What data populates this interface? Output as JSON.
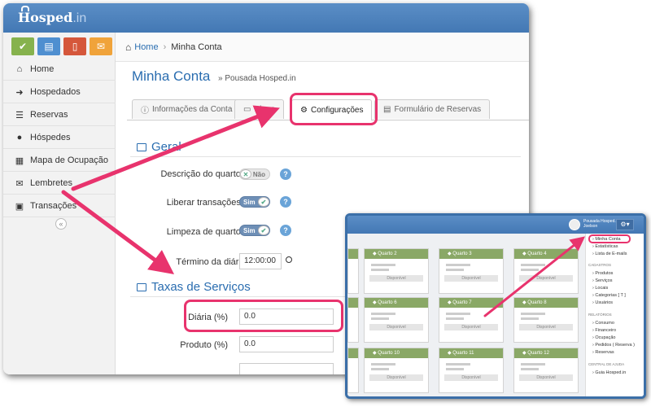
{
  "app": {
    "logo": "Hosped",
    "logo_dot": ".in"
  },
  "sidebar": {
    "quick_buttons": [
      {
        "icon": "check-icon",
        "color": "#86b24d"
      },
      {
        "icon": "book-icon",
        "color": "#4f8fd0"
      },
      {
        "icon": "tablet-icon",
        "color": "#d5573b"
      },
      {
        "icon": "inbox-icon",
        "color": "#f0a33a"
      }
    ],
    "items": [
      {
        "label": "Home",
        "icon": "home-icon"
      },
      {
        "label": "Hospedados",
        "icon": "sign-in-icon"
      },
      {
        "label": "Reservas",
        "icon": "list-icon"
      },
      {
        "label": "Hóspedes",
        "icon": "users-icon"
      },
      {
        "label": "Mapa de Ocupação",
        "icon": "calendar-icon"
      },
      {
        "label": "Lembretes",
        "icon": "envelope-icon"
      },
      {
        "label": "Transações",
        "icon": "money-icon"
      }
    ]
  },
  "breadcrumb": {
    "home": "Home",
    "current": "Minha Conta"
  },
  "page": {
    "title": "Minha Conta",
    "subtitle": "» Pousada Hosped.in"
  },
  "tabs": [
    {
      "label": "Informações da Conta",
      "icon": "info-icon",
      "active": false
    },
    {
      "label": "Plano",
      "icon": "card-icon",
      "active": false
    },
    {
      "label": "Configurações",
      "icon": "gears-icon",
      "active": true
    },
    {
      "label": "Formulário de Reservas",
      "icon": "form-icon",
      "active": false
    }
  ],
  "settings": {
    "section_geral": "Geral",
    "fields": [
      {
        "label": "Descrição do quarto?",
        "toggle": "Não",
        "state": "off"
      },
      {
        "label": "Liberar transações?",
        "toggle": "Sim",
        "state": "on"
      },
      {
        "label": "Limpeza de quarto?",
        "toggle": "Sim",
        "state": "on"
      }
    ],
    "termino": {
      "label": "Término da diária",
      "value": "12:00:00"
    },
    "section_taxas": "Taxas de Serviços",
    "diaria": {
      "label": "Diária (%)",
      "value": "0.0"
    },
    "produto": {
      "label": "Produto (%)",
      "value": "0.0"
    }
  },
  "inset": {
    "user": {
      "line1": "Pousada Hosped.in",
      "line2": "Joelson"
    },
    "rooms": [
      {
        "name": "Quarto 2",
        "status": "Disponível"
      },
      {
        "name": "Quarto 3",
        "status": "Disponível"
      },
      {
        "name": "Quarto 4",
        "status": "Disponível"
      },
      {
        "name": "Quarto 6",
        "status": "Disponível"
      },
      {
        "name": "Quarto 7",
        "status": "Disponível"
      },
      {
        "name": "Quarto 8",
        "status": "Disponível"
      },
      {
        "name": "Quarto 10",
        "status": "Disponível"
      },
      {
        "name": "Quarto 11",
        "status": "Disponível"
      },
      {
        "name": "Quarto 12",
        "status": "Disponível"
      }
    ],
    "menu": {
      "top": [
        "Minha Conta",
        "Estatísticas",
        "Lista de E-mails"
      ],
      "cadastros_header": "CADASTROS",
      "cadastros": [
        "Produtos",
        "Serviços",
        "Locais",
        "Categorias [ T ]",
        "Usuários"
      ],
      "relatorios_header": "RELATÓRIOS",
      "relatorios": [
        "Consumo",
        "Financeiro",
        "Ocupação",
        "Pedidos ( Reserva )",
        "Reservas"
      ],
      "ajuda_header": "CENTRAL DE AJUDA",
      "ajuda": [
        "Guia Hosped.in"
      ]
    }
  },
  "colors": {
    "accent": "#2a6db0",
    "highlight": "#e8336d",
    "topbar": "#4a7fbb",
    "room_header": "#8aa866"
  }
}
